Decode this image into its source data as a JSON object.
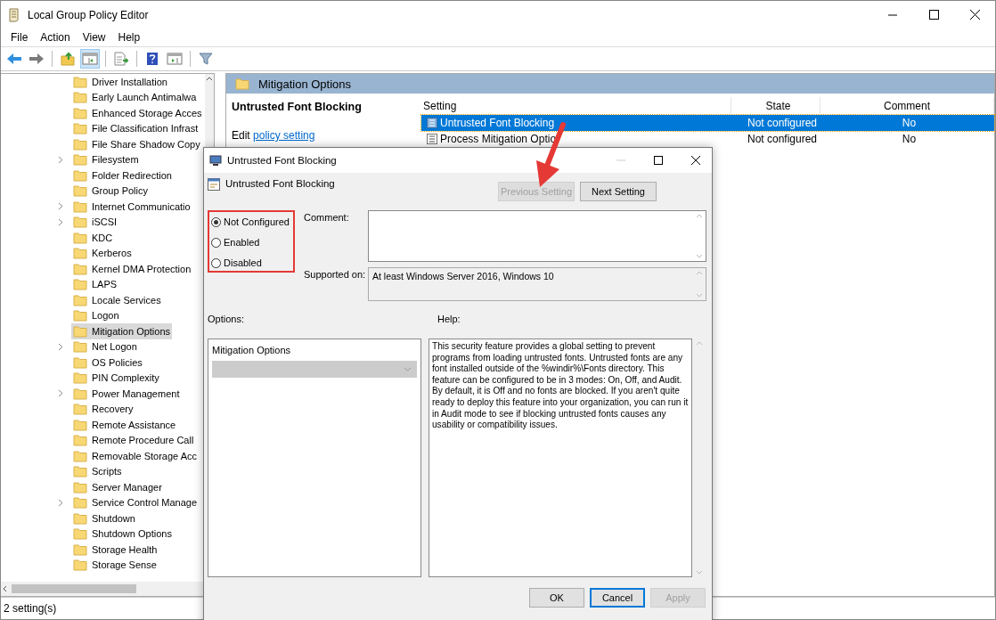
{
  "window": {
    "title": "Local Group Policy Editor"
  },
  "menu": [
    "File",
    "Action",
    "View",
    "Help"
  ],
  "toolbar": [
    {
      "kind": "back",
      "pressed": false
    },
    {
      "kind": "forward",
      "pressed": false
    },
    {
      "kind": "up",
      "pressed": false
    },
    {
      "kind": "tree",
      "pressed": true
    },
    {
      "kind": "export",
      "pressed": false
    },
    {
      "kind": "help",
      "pressed": false
    },
    {
      "kind": "pane",
      "pressed": false
    },
    {
      "kind": "filter",
      "pressed": false
    }
  ],
  "tree": [
    {
      "label": "Driver Installation",
      "expandable": false,
      "selected": false
    },
    {
      "label": "Early Launch Antimalwa",
      "expandable": false,
      "selected": false
    },
    {
      "label": "Enhanced Storage Acces",
      "expandable": false,
      "selected": false
    },
    {
      "label": "File Classification Infrast",
      "expandable": false,
      "selected": false
    },
    {
      "label": "File Share Shadow Copy",
      "expandable": false,
      "selected": false
    },
    {
      "label": "Filesystem",
      "expandable": true,
      "selected": false
    },
    {
      "label": "Folder Redirection",
      "expandable": false,
      "selected": false
    },
    {
      "label": "Group Policy",
      "expandable": false,
      "selected": false
    },
    {
      "label": "Internet Communicatio",
      "expandable": true,
      "selected": false
    },
    {
      "label": "iSCSI",
      "expandable": true,
      "selected": false
    },
    {
      "label": "KDC",
      "expandable": false,
      "selected": false
    },
    {
      "label": "Kerberos",
      "expandable": false,
      "selected": false
    },
    {
      "label": "Kernel DMA Protection",
      "expandable": false,
      "selected": false
    },
    {
      "label": "LAPS",
      "expandable": false,
      "selected": false
    },
    {
      "label": "Locale Services",
      "expandable": false,
      "selected": false
    },
    {
      "label": "Logon",
      "expandable": false,
      "selected": false
    },
    {
      "label": "Mitigation Options",
      "expandable": false,
      "selected": true
    },
    {
      "label": "Net Logon",
      "expandable": true,
      "selected": false
    },
    {
      "label": "OS Policies",
      "expandable": false,
      "selected": false
    },
    {
      "label": "PIN Complexity",
      "expandable": false,
      "selected": false
    },
    {
      "label": "Power Management",
      "expandable": true,
      "selected": false
    },
    {
      "label": "Recovery",
      "expandable": false,
      "selected": false
    },
    {
      "label": "Remote Assistance",
      "expandable": false,
      "selected": false
    },
    {
      "label": "Remote Procedure Call",
      "expandable": false,
      "selected": false
    },
    {
      "label": "Removable Storage Acc",
      "expandable": false,
      "selected": false
    },
    {
      "label": "Scripts",
      "expandable": false,
      "selected": false
    },
    {
      "label": "Server Manager",
      "expandable": false,
      "selected": false
    },
    {
      "label": "Service Control Manage",
      "expandable": true,
      "selected": false
    },
    {
      "label": "Shutdown",
      "expandable": false,
      "selected": false
    },
    {
      "label": "Shutdown Options",
      "expandable": false,
      "selected": false
    },
    {
      "label": "Storage Health",
      "expandable": false,
      "selected": false
    },
    {
      "label": "Storage Sense",
      "expandable": false,
      "selected": false
    }
  ],
  "details": {
    "header": "Mitigation Options",
    "setting_title": "Untrusted Font Blocking",
    "edit_prefix": "Edit",
    "edit_link": "policy setting",
    "columns": [
      "Setting",
      "State",
      "Comment"
    ],
    "rows": [
      {
        "kind": "font",
        "setting": "Untrusted Font Blocking",
        "state": "Not configured",
        "comment": "No",
        "selected": true
      },
      {
        "kind": "list",
        "setting": "Process Mitigation Optio",
        "state": "Not configured",
        "comment": "No",
        "selected": false
      }
    ]
  },
  "status_bar": "2 setting(s)",
  "dialog": {
    "title": "Untrusted Font Blocking",
    "heading": "Untrusted Font Blocking",
    "nav_buttons": [
      {
        "label": "Previous Setting",
        "disabled": true
      },
      {
        "label": "Next Setting",
        "disabled": false
      }
    ],
    "choices": [
      {
        "label": "Not Configured",
        "selected": true
      },
      {
        "label": "Enabled",
        "selected": false
      },
      {
        "label": "Disabled",
        "selected": false
      }
    ],
    "comment_label": "Comment:",
    "supported_label": "Supported on:",
    "supported_text": "At least Windows Server 2016, Windows 10",
    "options_label": "Options:",
    "help_label": "Help:",
    "options_panel": {
      "label": "Mitigation Options",
      "dropdown_disabled": true
    },
    "help_text": "This security feature provides a global setting to prevent programs from loading untrusted fonts. Untrusted fonts are any font installed outside of the %windir%\\Fonts directory. This feature can be configured to be in 3 modes: On, Off, and Audit. By default, it is Off and no fonts are blocked. If you aren't quite ready to deploy this feature into your organization, you can run it in Audit mode to see if blocking untrusted fonts causes any usability or compatibility issues.",
    "buttons": [
      {
        "label": "OK",
        "disabled": false,
        "default": false
      },
      {
        "label": "Cancel",
        "disabled": false,
        "default": true
      },
      {
        "label": "Apply",
        "disabled": true,
        "default": false
      }
    ]
  }
}
